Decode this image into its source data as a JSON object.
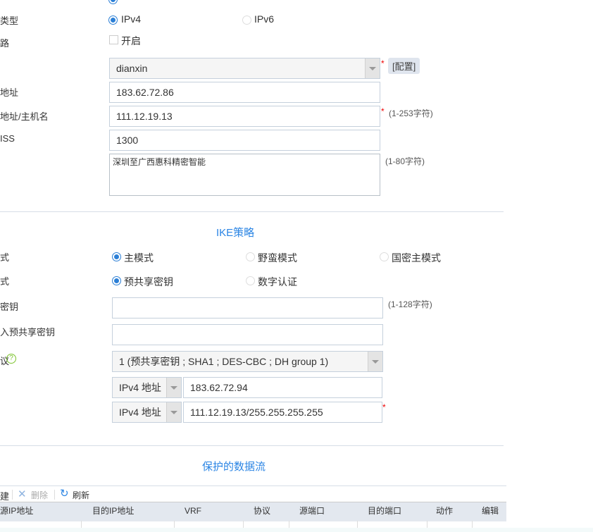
{
  "basic": {
    "ip_type_label": "类型",
    "ip_type_options": [
      "IPv4",
      "IPv6"
    ],
    "link_label": "路",
    "link_checkbox": "开启",
    "line_value": "dianxin",
    "config_button": "[配置]",
    "local_addr_label": "地址",
    "local_addr_value": "183.62.72.86",
    "peer_label": "地址/主机名",
    "peer_value": "111.12.19.13",
    "peer_hint": "(1-253字符)",
    "mss_label": "ISS",
    "mss_value": "1300",
    "desc_value": "深圳至广西惠科精密智能",
    "desc_hint": "(1-80字符)",
    "required": "*"
  },
  "ike": {
    "title": "IKE策略",
    "mode_label": "式",
    "mode_options": [
      "主模式",
      "野蛮模式",
      "国密主模式"
    ],
    "auth_label": "式",
    "auth_options": [
      "预共享密钥",
      "数字认证"
    ],
    "psk_label": "密钥",
    "psk_hint": "(1-128字符)",
    "psk_confirm_label": "入预共享密钥",
    "proposal_label": "议",
    "proposal_value": "1 (预共享密钥 ; SHA1 ; DES-CBC ; DH group 1)",
    "local_type": "IPv4 地址",
    "local_value": "183.62.72.94",
    "remote_type": "IPv4 地址",
    "remote_value": "111.12.19.13/255.255.255.255"
  },
  "flow": {
    "title": "保护的数据流",
    "toolbar": {
      "new": "建",
      "delete": "删除",
      "refresh": "刷新"
    },
    "columns": [
      "源IP地址",
      "目的IP地址",
      "VRF",
      "协议",
      "源端口",
      "目的端口",
      "动作",
      "编辑"
    ]
  }
}
